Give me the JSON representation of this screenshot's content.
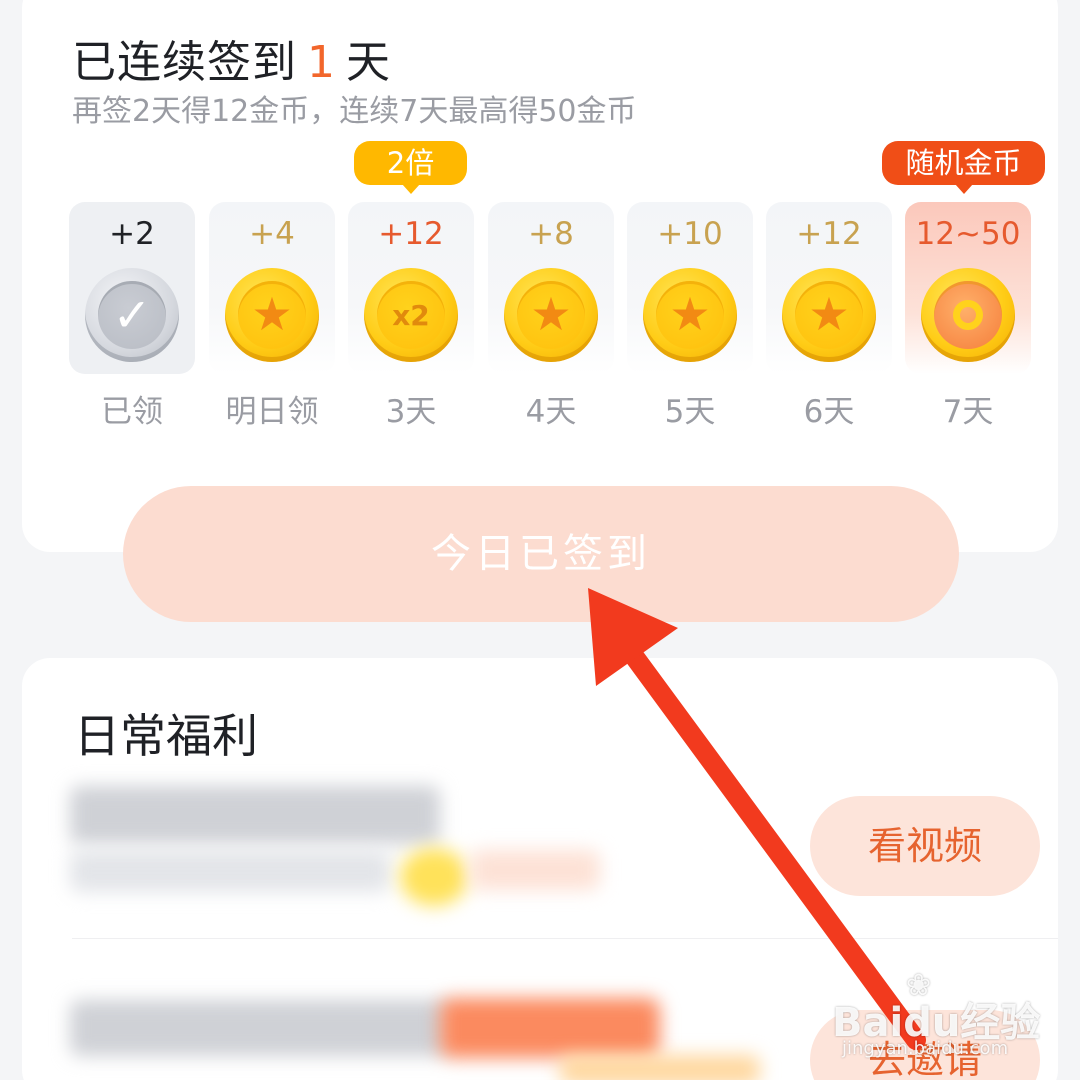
{
  "checkin": {
    "title_prefix": "已连续签到",
    "streak_days": "1",
    "title_suffix": "天",
    "subtitle": "再签2天得12金币，连续7天最高得50金币",
    "tags": {
      "double": "2倍",
      "random": "随机金币"
    },
    "days": [
      {
        "amount": "+2",
        "label": "已领",
        "state": "claimed",
        "icon": "check-icon"
      },
      {
        "amount": "+4",
        "label": "明日领",
        "state": "upcoming",
        "icon": "star-icon"
      },
      {
        "amount": "+12",
        "label": "3天",
        "state": "doubled",
        "icon": "x2-icon",
        "coin_text": "x2"
      },
      {
        "amount": "+8",
        "label": "4天",
        "state": "upcoming",
        "icon": "star-icon"
      },
      {
        "amount": "+10",
        "label": "5天",
        "state": "upcoming",
        "icon": "star-icon"
      },
      {
        "amount": "+12",
        "label": "6天",
        "state": "upcoming",
        "icon": "star-icon"
      },
      {
        "amount": "12~50",
        "label": "7天",
        "state": "random",
        "icon": "dial-icon"
      }
    ],
    "button_label": "今日已签到"
  },
  "daily_benefits": {
    "title": "日常福利",
    "tasks": [
      {
        "action_label": "看视频"
      },
      {
        "action_label": "去邀请"
      }
    ]
  },
  "watermark": {
    "text": "Baidu经验",
    "url": "jingyan.baidu.com"
  },
  "colors": {
    "accent": "#f2662b",
    "gold": "#ffcc16",
    "arrow": "#f23a1e",
    "button_bg": "#fcdcd0"
  }
}
